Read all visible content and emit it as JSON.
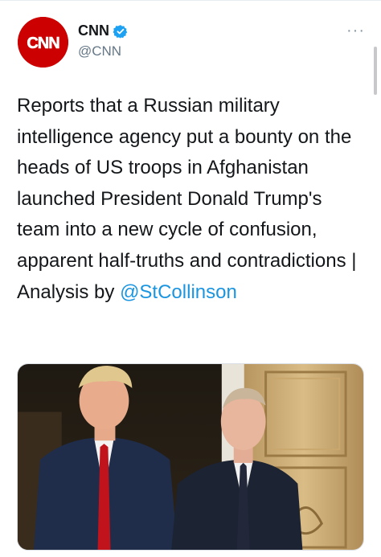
{
  "account": {
    "avatar_text": "CNN",
    "name": "CNN",
    "handle": "@CNN",
    "verified": true
  },
  "menu": {
    "more_label": "···"
  },
  "tweet": {
    "text": "Reports that a Russian military intelligence agency put a bounty on the heads of US troops in Afghanistan launched President Donald Trump's team into a new cycle of confusion, apparent half-truths and contradictions | Analysis by ",
    "mention": "@StCollinson"
  },
  "colors": {
    "cnn_red": "#cc0000",
    "link_blue": "#1b95e0",
    "verified_blue": "#1da1f2",
    "muted_gray": "#657786"
  },
  "icons": {
    "verified": "verified-badge-icon",
    "more": "more-options-icon"
  }
}
